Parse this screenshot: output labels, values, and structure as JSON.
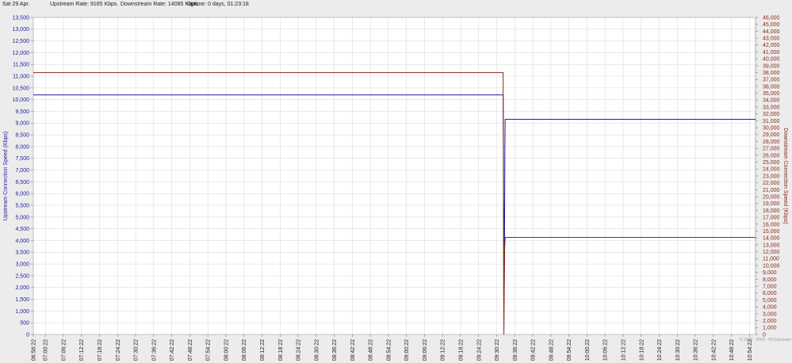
{
  "status": {
    "date": "Sat 29 Apr.",
    "upstream_rate": "Upstream Rate: 9165 Kbps.",
    "downstream_rate": "Downstream Rate: 14085 Kbps.",
    "uptime": "Uptime: 0 days, 01:23:18"
  },
  "watermark": "© 2000 - 2009 - 05 Dsprouter",
  "colors": {
    "upstream": "#1e1ea0",
    "downstream": "#8b2a1a",
    "upstream_axis_text": "#1e1ea0",
    "downstream_axis_text": "#8b2a1a",
    "grid": "#d6d6d6",
    "plot_background": "#ffffff"
  },
  "chart_data": {
    "type": "line",
    "xlabel": "",
    "ylabel_left": "Upstream Connection Speed (Kbps)",
    "ylabel_right": "Downstream Connection Speed (Kbps)",
    "ylim_left": [
      0,
      13500
    ],
    "ylim_right": [
      0,
      46000
    ],
    "yticks_left": [
      "0",
      "500",
      "1,000",
      "1,500",
      "2,000",
      "2,500",
      "3,000",
      "3,500",
      "4,000",
      "4,500",
      "5,000",
      "5,500",
      "6,000",
      "6,500",
      "7,000",
      "7,500",
      "8,000",
      "8,500",
      "9,000",
      "9,500",
      "10,000",
      "10,500",
      "11,000",
      "11,500",
      "12,000",
      "12,500",
      "13,000",
      "13,500"
    ],
    "yticks_right": [
      "0",
      "1,000",
      "2,000",
      "3,000",
      "4,000",
      "5,000",
      "6,000",
      "7,000",
      "8,000",
      "9,000",
      "10,000",
      "11,000",
      "12,000",
      "13,000",
      "14,000",
      "15,000",
      "16,000",
      "17,000",
      "18,000",
      "19,000",
      "20,000",
      "21,000",
      "22,000",
      "23,000",
      "24,000",
      "25,000",
      "26,000",
      "27,000",
      "28,000",
      "29,000",
      "30,000",
      "31,000",
      "32,000",
      "33,000",
      "34,000",
      "35,000",
      "36,000",
      "37,000",
      "38,000",
      "39,000",
      "40,000",
      "41,000",
      "42,000",
      "43,000",
      "44,000",
      "45,000",
      "46,000"
    ],
    "x_ticks": [
      "06:56:22",
      "07:00:22",
      "07:06:22",
      "07:12:22",
      "07:18:22",
      "07:24:22",
      "07:30:22",
      "07:36:22",
      "07:42:22",
      "07:48:22",
      "07:54:22",
      "08:00:22",
      "08:06:22",
      "08:12:22",
      "08:18:22",
      "08:24:22",
      "08:30:22",
      "08:36:22",
      "08:42:22",
      "08:48:22",
      "08:54:22",
      "09:00:22",
      "09:06:22",
      "09:12:22",
      "09:18:22",
      "09:24:22",
      "09:30:22",
      "09:36:22",
      "09:42:22",
      "09:48:22",
      "09:54:22",
      "10:00:22",
      "10:06:22",
      "10:12:22",
      "10:18:22",
      "10:24:22",
      "10:30:22",
      "10:36:22",
      "10:42:22",
      "10:48:22",
      "10:54:22"
    ],
    "xlim": [
      "06:56:22",
      "10:56:22"
    ],
    "grid": true,
    "series": [
      {
        "name": "Upstream Connection Speed (Kbps)",
        "axis": "left",
        "points": [
          {
            "t": "06:56:22",
            "v": 10200
          },
          {
            "t": "09:32:30",
            "v": 10200
          },
          {
            "t": "09:32:30",
            "v": 9600
          },
          {
            "t": "09:32:35",
            "v": 8500
          },
          {
            "t": "09:32:40",
            "v": 5700
          },
          {
            "t": "09:32:45",
            "v": 5100
          },
          {
            "t": "09:32:50",
            "v": 1600
          },
          {
            "t": "09:32:55",
            "v": 3000
          },
          {
            "t": "09:33:05",
            "v": 8000
          },
          {
            "t": "09:33:10",
            "v": 9165
          },
          {
            "t": "10:56:22",
            "v": 9165
          }
        ]
      },
      {
        "name": "Downstream Connection Speed (Kbps)",
        "axis": "right",
        "points": [
          {
            "t": "06:56:22",
            "v": 38000
          },
          {
            "t": "09:32:30",
            "v": 38000
          },
          {
            "t": "09:32:40",
            "v": 6000
          },
          {
            "t": "09:32:45",
            "v": 0
          },
          {
            "t": "09:32:55",
            "v": 9000
          },
          {
            "t": "09:33:00",
            "v": 12500
          },
          {
            "t": "09:33:10",
            "v": 14085
          },
          {
            "t": "10:56:22",
            "v": 14085
          }
        ]
      }
    ]
  }
}
